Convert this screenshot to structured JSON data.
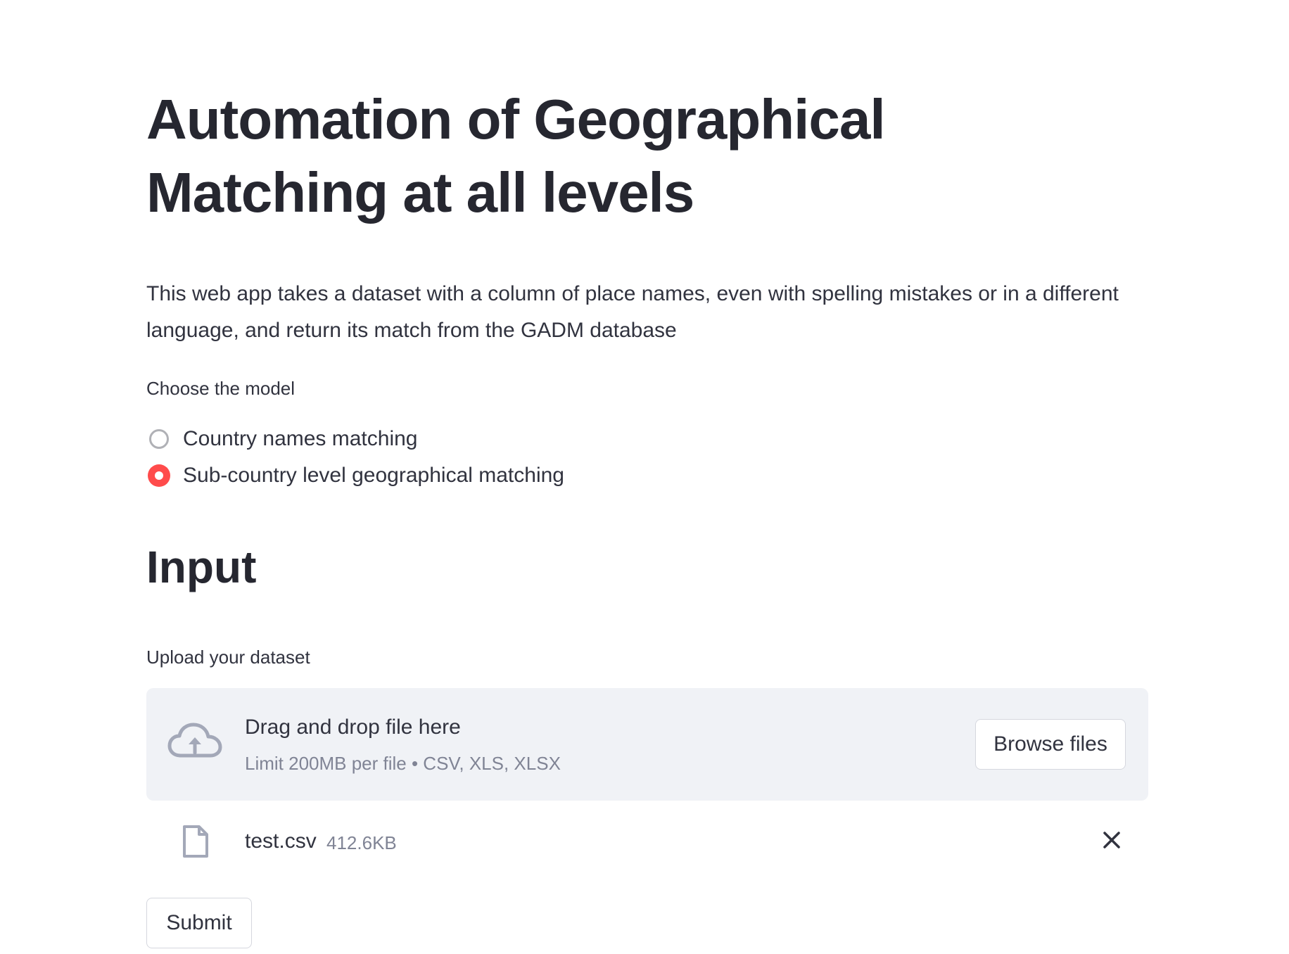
{
  "header": {
    "title": "Automation of Geographical Matching at all levels",
    "description": "This web app takes a dataset with a column of place names, even with spelling mistakes or in a different language, and return its match from the GADM database"
  },
  "model_select": {
    "label": "Choose the model",
    "options": [
      {
        "label": "Country names matching",
        "selected": false
      },
      {
        "label": "Sub-country level geographical matching",
        "selected": true
      }
    ]
  },
  "input_section": {
    "heading": "Input",
    "upload": {
      "label": "Upload your dataset",
      "dropzone_title": "Drag and drop file here",
      "dropzone_hint": "Limit 200MB per file • CSV, XLS, XLSX",
      "browse_label": "Browse files",
      "icon": "cloud-upload-icon"
    },
    "uploaded_file": {
      "name": "test.csv",
      "size": "412.6KB",
      "icon": "file-icon",
      "remove_icon": "close-icon"
    },
    "submit_label": "Submit"
  },
  "colors": {
    "accent": "#ff4b4b",
    "text": "#31333f",
    "muted": "#808495",
    "dropzone_bg": "#f0f2f6",
    "icon": "#a3a8b8"
  }
}
